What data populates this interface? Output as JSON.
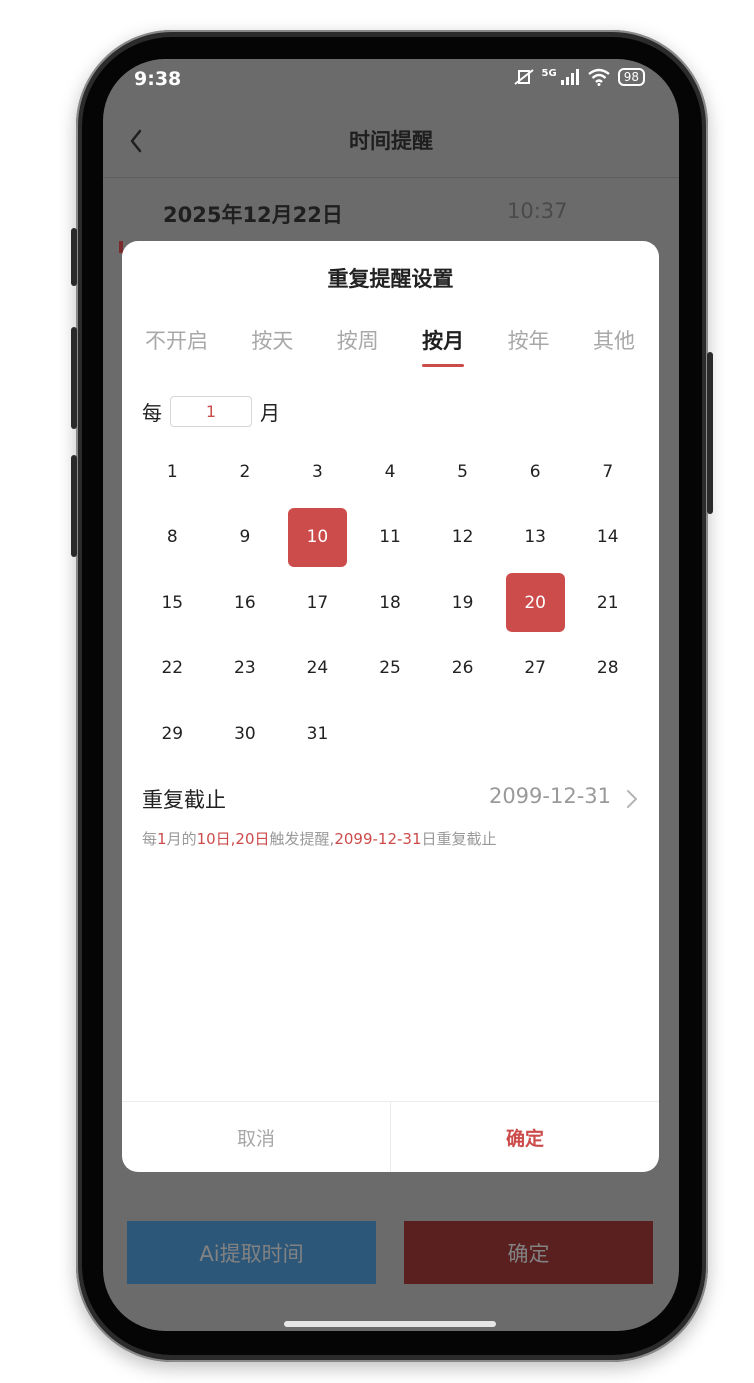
{
  "status_bar": {
    "time": "9:38",
    "network": "5G",
    "battery": "98"
  },
  "header": {
    "title": "时间提醒"
  },
  "date_row": {
    "date": "2025年12月22日",
    "time": "10:37"
  },
  "modal": {
    "title": "重复提醒设置",
    "tabs": [
      "不开启",
      "按天",
      "按周",
      "按月",
      "按年",
      "其他"
    ],
    "active_tab": "按月",
    "every": {
      "prefix": "每",
      "value": "1",
      "suffix": "月"
    },
    "calendar_rows": [
      [
        "1",
        "2",
        "3",
        "4",
        "5",
        "6",
        "7"
      ],
      [
        "8",
        "9",
        "10",
        "11",
        "12",
        "13",
        "14"
      ],
      [
        "15",
        "16",
        "17",
        "18",
        "19",
        "20",
        "21"
      ],
      [
        "22",
        "23",
        "24",
        "25",
        "26",
        "27",
        "28"
      ],
      [
        "29",
        "30",
        "31"
      ]
    ],
    "selected_days": [
      "10",
      "20"
    ],
    "repeat_end": {
      "label": "重复截止",
      "value": "2099-12-31"
    },
    "summary": {
      "p1": "每",
      "h1": "1",
      "p2": "月的",
      "h2": "10日,20日",
      "p3": "触发提醒,",
      "h3": "2099-12-31",
      "p4": "日重复截止"
    },
    "footer": {
      "cancel": "取消",
      "ok": "确定"
    }
  },
  "bottom": {
    "ai_button": "Ai提取时间",
    "confirm_button": "确定"
  },
  "colors": {
    "accent": "#cc4b4b",
    "ai_button": "#2c5779",
    "overlay": "#6b6b6b"
  }
}
